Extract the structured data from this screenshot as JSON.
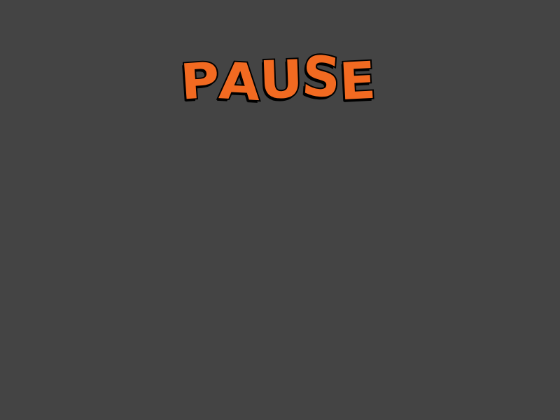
{
  "pause_screen": {
    "title": "PAUSE",
    "letters": [
      "P",
      "A",
      "U",
      "S",
      "E"
    ]
  },
  "colors": {
    "background": "#444444",
    "title_fill": "#f26a21",
    "title_outline": "#000000"
  }
}
